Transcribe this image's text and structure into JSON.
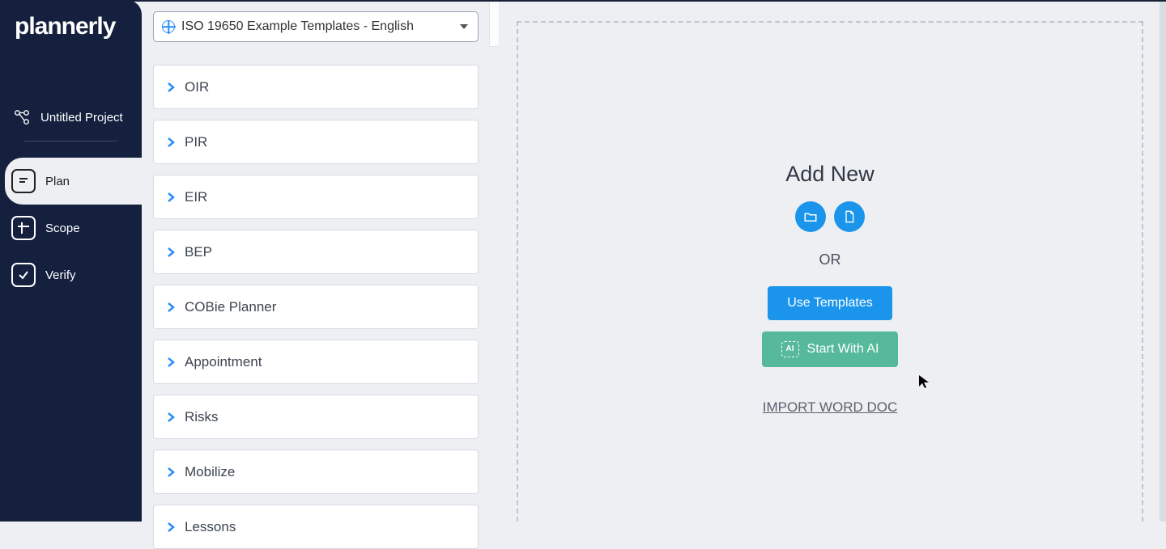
{
  "brand": "plannerly",
  "project": {
    "name": "Untitled Project"
  },
  "nav": {
    "items": [
      {
        "label": "Plan",
        "icon": "plan-icon",
        "active": true
      },
      {
        "label": "Scope",
        "icon": "scope-icon",
        "active": false
      },
      {
        "label": "Verify",
        "icon": "verify-icon",
        "active": false
      }
    ]
  },
  "template_select": {
    "value": "ISO 19650 Example Templates - English"
  },
  "template_items": [
    {
      "label": "OIR"
    },
    {
      "label": "PIR"
    },
    {
      "label": "EIR"
    },
    {
      "label": "BEP"
    },
    {
      "label": "COBie Planner"
    },
    {
      "label": "Appointment"
    },
    {
      "label": "Risks"
    },
    {
      "label": "Mobilize"
    },
    {
      "label": "Lessons"
    }
  ],
  "canvas": {
    "title": "Add New",
    "or": "OR",
    "use_templates": "Use Templates",
    "start_ai": "Start With AI",
    "ai_chip": "AI",
    "import": "IMPORT WORD DOC"
  }
}
